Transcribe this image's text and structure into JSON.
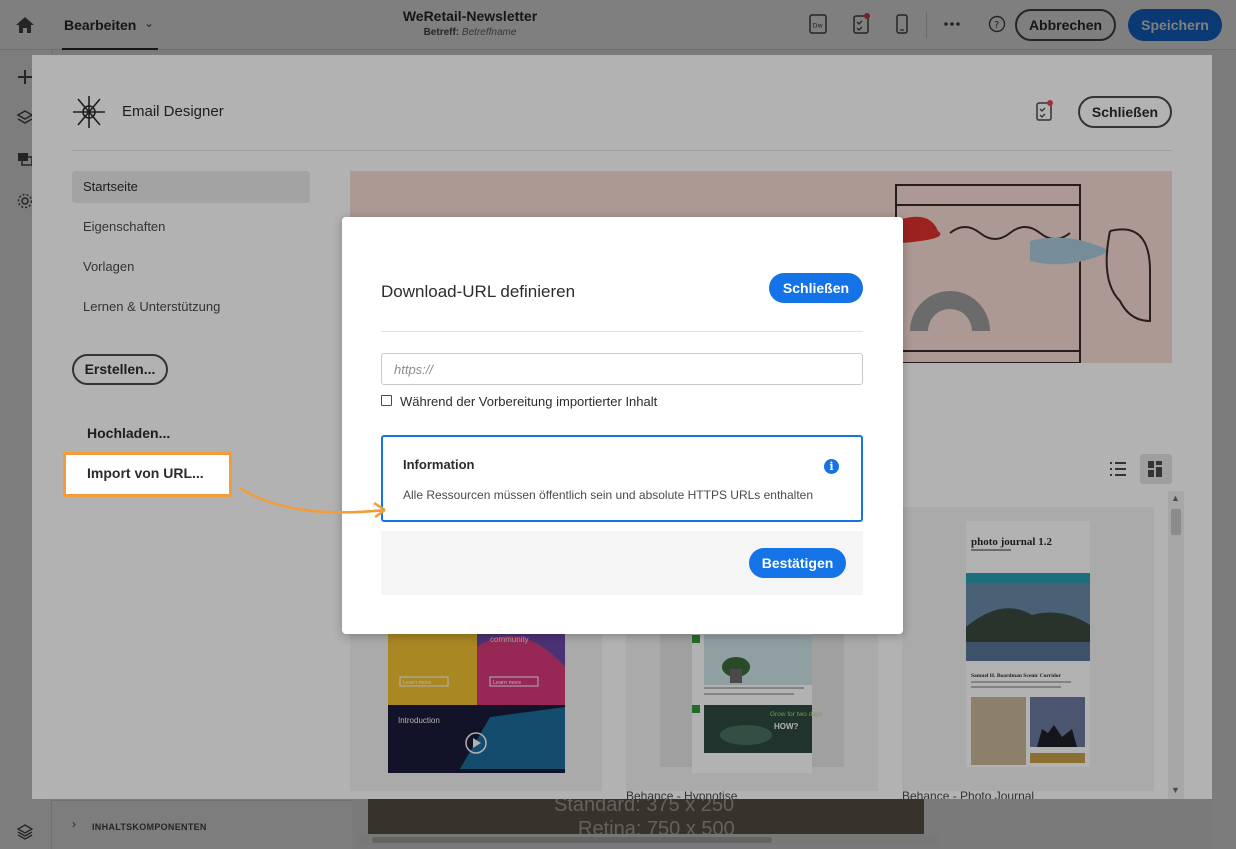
{
  "topbar": {
    "edit_tab": "Bearbeiten",
    "title": "WeRetail-Newsletter",
    "subject_label": "Betreff:",
    "subject_value": "Betreffname",
    "cancel_label": "Abbrechen",
    "save_label": "Speichern",
    "icons": [
      "home-icon",
      "dreamweaver-icon",
      "checklist-icon",
      "mobile-preview-icon",
      "more-icon",
      "help-icon"
    ]
  },
  "bottom_strip": {
    "section_label": "INHALTSKOMPONENTEN"
  },
  "bottom_preview": {
    "line1": "Standard: 375 x 250",
    "line2": "Retina: 750 x 500"
  },
  "designer": {
    "title": "Email Designer",
    "close_label": "Schließen",
    "nav_items": [
      "Startseite",
      "Eigenschaften",
      "Vorlagen",
      "Lernen & Unterstützung"
    ],
    "create_label": "Erstellen...",
    "upload_label": "Hochladen...",
    "import_url_label": "Import von URL...",
    "cards": [
      {
        "caption": "",
        "community": "community",
        "learn1": "Learn more",
        "learn2": "Learn more",
        "intro": "Introduction"
      },
      {
        "caption": "Behance - Hypnotise",
        "grow": "Grow for two days",
        "how": "HOW?"
      },
      {
        "caption": "Behance - Photo Journal",
        "pj_title": "photo journal 1.2",
        "pj_sub": "Samuel H. Boardman Scenic Corridor"
      }
    ]
  },
  "modal": {
    "title": "Download-URL definieren",
    "close_label": "Schließen",
    "url_placeholder": "https://",
    "checkbox_label": "Während der Vorbereitung importierter Inhalt",
    "info_title": "Information",
    "info_text": "Alle Ressourcen müssen öffentlich sein und absolute HTTPS URLs enthalten",
    "confirm_label": "Bestätigen"
  },
  "colors": {
    "accent": "#1473e6",
    "highlight": "#f29c3a",
    "banner_bg": "#f7dcd3"
  }
}
